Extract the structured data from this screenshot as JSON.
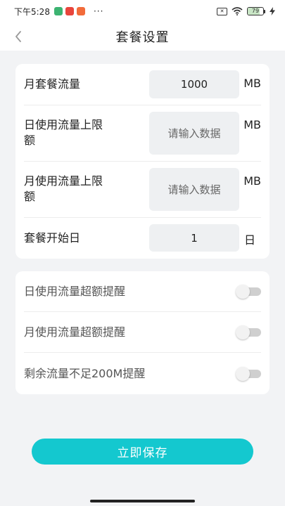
{
  "status_bar": {
    "time": "下午5:28",
    "more": "···",
    "battery": "79",
    "battery_level": 0.79
  },
  "header": {
    "title": "套餐设置"
  },
  "plan": {
    "monthly_quota": {
      "label": "月套餐流量",
      "value": "1000",
      "unit": "MB"
    },
    "daily_limit": {
      "label_line1": "日使用流量上限",
      "label_line2": "额",
      "placeholder": "请输入数据",
      "unit": "MB"
    },
    "monthly_limit": {
      "label_line1": "月使用流量上限",
      "label_line2": "额",
      "placeholder": "请输入数据",
      "unit": "MB"
    },
    "start_day": {
      "label": "套餐开始日",
      "value": "1",
      "unit": "日"
    }
  },
  "alerts": [
    {
      "label": "日使用流量超额提醒",
      "enabled": false
    },
    {
      "label": "月使用流量超额提醒",
      "enabled": false
    },
    {
      "label": "剩余流量不足200M提醒",
      "enabled": false
    }
  ],
  "save_label": "立即保存",
  "colors": {
    "accent": "#14c8cf",
    "background": "#f2f3f5"
  }
}
